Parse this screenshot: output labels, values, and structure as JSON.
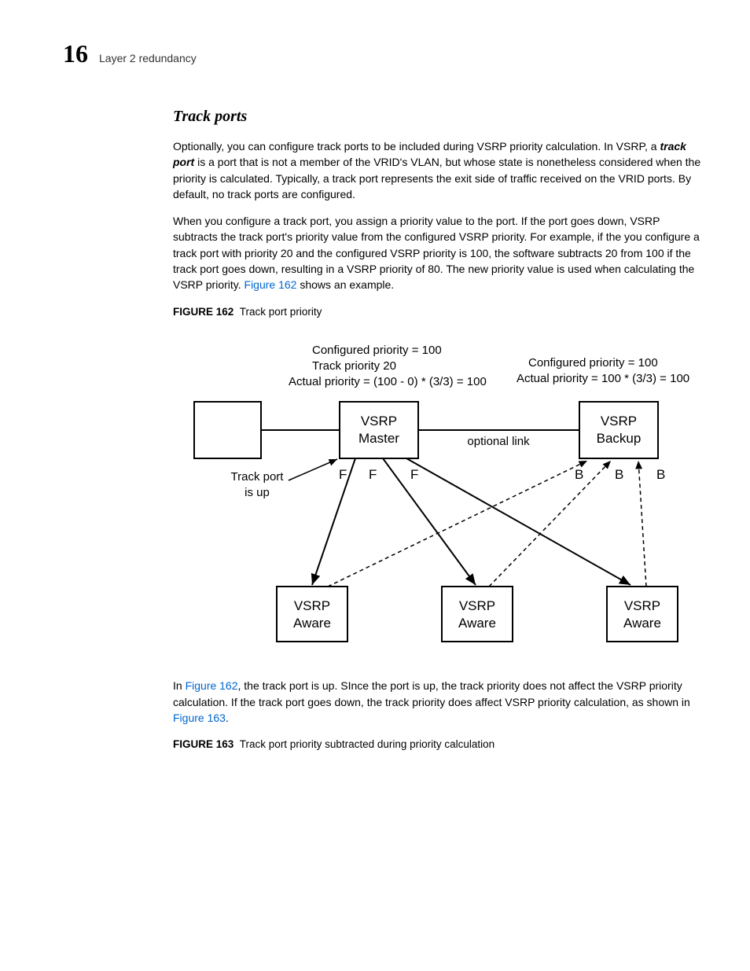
{
  "header": {
    "chapter_number": "16",
    "chapter_title": "Layer 2 redundancy"
  },
  "section_title": "Track ports",
  "para1_pre": "Optionally, you can configure track ports to be included during VSRP priority calculation. In VSRP, a ",
  "para1_term": "track port",
  "para1_post": " is a port that is not a member of the VRID's VLAN, but whose state is nonetheless considered when the priority is calculated. Typically, a track port represents the exit side of traffic received on the VRID ports. By default, no track ports are configured.",
  "para2_pre": "When you configure a track port, you assign a priority value to the port. If the port goes down, VSRP subtracts the track port's priority value from the configured VSRP priority. For example, if the you configure a track port with priority 20 and the configured VSRP priority is 100, the software subtracts 20 from 100 if the track port goes down, resulting in a VSRP priority of 80. The new priority value is used when calculating the VSRP priority. ",
  "para2_link": "Figure 162",
  "para2_post": " shows an example.",
  "fig162_num": "FIGURE 162",
  "fig162_title": "Track port priority",
  "diagram": {
    "master_info_l1": "Configured priority = 100",
    "master_info_l2": "Track priority 20",
    "master_info_l3": "Actual priority = (100 - 0) * (3/3) = 100",
    "backup_info_l1": "Configured priority = 100",
    "backup_info_l2": "Actual priority = 100 * (3/3) = 100",
    "master_l1": "VSRP",
    "master_l2": "Master",
    "backup_l1": "VSRP",
    "backup_l2": "Backup",
    "optional_link": "optional link",
    "track_l1": "Track port",
    "track_l2": "is up",
    "F": "F",
    "B": "B",
    "aware_l1": "VSRP",
    "aware_l2": "Aware"
  },
  "para3_pre": "In ",
  "para3_link1": "Figure 162",
  "para3_mid": ", the track port is up. SInce the port is up, the track priority does not affect the VSRP priority calculation. If the track port goes down, the track priority does affect VSRP priority calculation, as shown in ",
  "para3_link2": "Figure 163",
  "para3_post": ".",
  "fig163_num": "FIGURE 163",
  "fig163_title": "Track port priority subtracted during priority calculation"
}
